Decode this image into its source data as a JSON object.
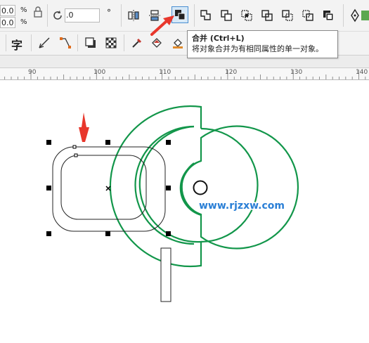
{
  "toolbar": {
    "width_value": "0.0",
    "height_value": "0.0",
    "unit_percent_top": "%",
    "unit_percent_bottom": "%",
    "rotation_value": ".0",
    "rotation_unit": "°",
    "text_tool_label": "字"
  },
  "tooltip": {
    "title": "合并 (Ctrl+L)",
    "description": "将对象合并为有相同属性的单一对象。"
  },
  "ruler": {
    "ticks": [
      "90",
      "100",
      "110",
      "120",
      "130",
      "140"
    ]
  },
  "watermark": "www.rjzxw.com",
  "colors": {
    "green_shape": "#12964a",
    "red_arrow": "#e8372c",
    "active_button": "#4a8fd1",
    "watermark_blue": "#2a7fd6"
  }
}
